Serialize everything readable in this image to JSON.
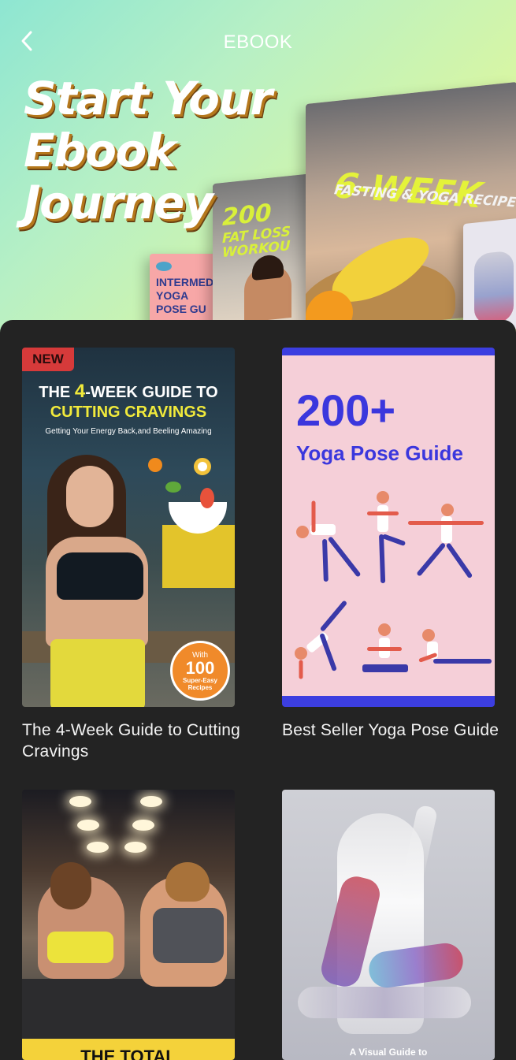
{
  "status": {
    "time": ""
  },
  "header": {
    "back_icon": "chevron-left-icon",
    "title": "EBOOK"
  },
  "hero": {
    "headline_lines": [
      "Start Your",
      "Ebook",
      "Journey"
    ],
    "books": [
      {
        "title": "INTERMED",
        "subtitle": "YOGA",
        "subtitle2": "POSE GU"
      },
      {
        "title": "200",
        "subtitle": "FAT LOSS",
        "subtitle2": "WORKOU"
      },
      {
        "title": "6-WEEK",
        "subtitle": "FASTING & YOGA RECIPE"
      }
    ]
  },
  "ebooks": [
    {
      "title": "The 4-Week Guide to Cutting Cravings",
      "cover": {
        "badge": "NEW",
        "line1_pre": "THE ",
        "line1_num": "4",
        "line1_post": "-WEEK GUIDE TO",
        "line2": "CUTTING CRAVINGS",
        "line3": "Getting Your Energy Back,and Beeling Amazing",
        "seal_top": "With",
        "seal_num": "100",
        "seal_bottom": "Super-Easy Recipes"
      }
    },
    {
      "title": "Best Seller Yoga Pose Guide",
      "cover": {
        "big": "200+",
        "mid": "Yoga Pose Guide"
      }
    },
    {
      "title": "",
      "cover": {
        "band_text": "THE TOTAL"
      }
    },
    {
      "title": "",
      "cover": {
        "caption": "A Visual Guide to"
      }
    }
  ],
  "colors": {
    "panel_bg": "#232323",
    "accent_blue": "#3c3ee0",
    "accent_yellow": "#f1ea3b",
    "badge_red": "#d63a3a"
  }
}
